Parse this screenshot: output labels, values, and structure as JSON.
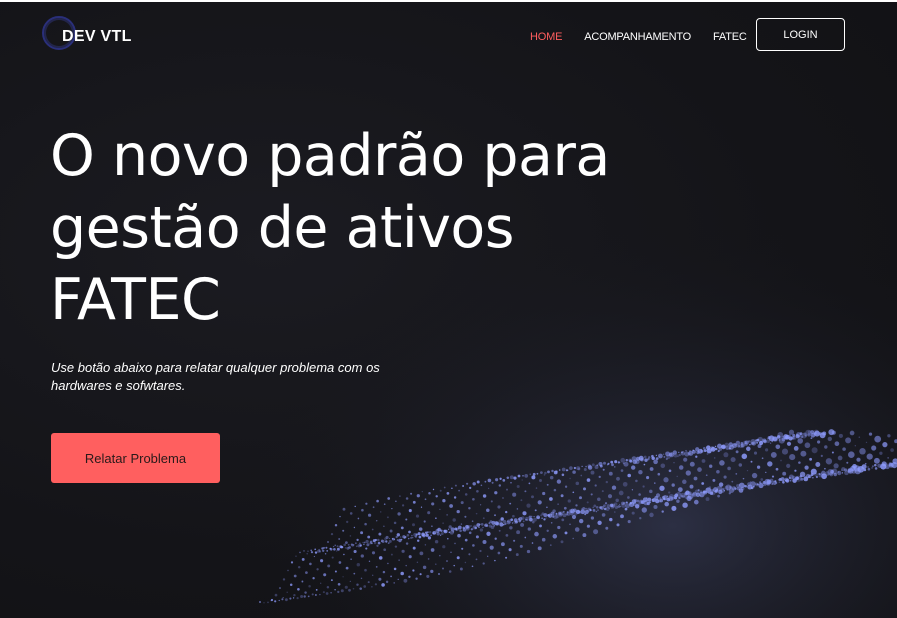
{
  "brand": {
    "name": "DEV VTL",
    "ring_color": "#2a2f7a"
  },
  "nav": {
    "items": [
      {
        "label": "HOME",
        "active": true
      },
      {
        "label": "ACOMPANHAMENTO",
        "active": false
      },
      {
        "label": "FATEC",
        "active": false
      }
    ],
    "login_label": "LOGIN"
  },
  "hero": {
    "title_lines": [
      "O novo padrão para",
      "gestão de ativos",
      "FATEC"
    ],
    "subtitle_line1": "Use botão abaixo para relatar qualquer problema com os",
    "subtitle_line2": "hardwares e sofwtares.",
    "cta_label": "Relatar Problema"
  },
  "colors": {
    "background": "#141418",
    "accent": "#ff5f5f",
    "active_nav": "#ff5e5e",
    "particles": "#8f9cff"
  }
}
